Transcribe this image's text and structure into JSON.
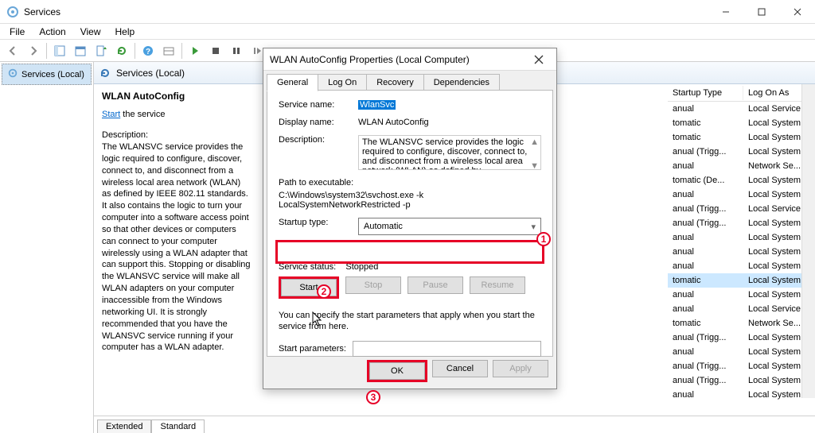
{
  "window": {
    "title": "Services"
  },
  "menu": {
    "file": "File",
    "action": "Action",
    "view": "View",
    "help": "Help"
  },
  "tree": {
    "root": "Services (Local)"
  },
  "svcHeader": "Services (Local)",
  "descPanel": {
    "name": "WLAN AutoConfig",
    "start_link": "Start",
    "start_suffix": " the service",
    "desc_label": "Description:",
    "desc_text": "The WLANSVC service provides the logic required to configure, discover, connect to, and disconnect from a wireless local area network (WLAN) as defined by IEEE 802.11 standards. It also contains the logic to turn your computer into a software access point so that other devices or computers can connect to your computer wirelessly using a WLAN adapter that can support this. Stopping or disabling the WLANSVC service will make all WLAN adapters on your computer inaccessible from the Windows networking UI. It is strongly recommended that you have the WLANSVC service running if your computer has a WLAN adapter."
  },
  "listHeader": {
    "startup": "Startup Type",
    "logon": "Log On As"
  },
  "rows": [
    {
      "st": "anual",
      "lo": "Local Service"
    },
    {
      "st": "tomatic",
      "lo": "Local System"
    },
    {
      "st": "tomatic",
      "lo": "Local System"
    },
    {
      "st": "anual (Trigg...",
      "lo": "Local System"
    },
    {
      "st": "anual",
      "lo": "Network Se..."
    },
    {
      "st": "tomatic (De...",
      "lo": "Local System"
    },
    {
      "st": "anual",
      "lo": "Local System"
    },
    {
      "st": "anual (Trigg...",
      "lo": "Local Service"
    },
    {
      "st": "anual (Trigg...",
      "lo": "Local System"
    },
    {
      "st": "anual",
      "lo": "Local System"
    },
    {
      "st": "anual",
      "lo": "Local System"
    },
    {
      "st": "anual",
      "lo": "Local System"
    },
    {
      "st": "tomatic",
      "lo": "Local System",
      "sel": true
    },
    {
      "st": "anual",
      "lo": "Local System"
    },
    {
      "st": "anual",
      "lo": "Local Service"
    },
    {
      "st": "tomatic",
      "lo": "Network Se..."
    },
    {
      "st": "anual (Trigg...",
      "lo": "Local System"
    },
    {
      "st": "anual",
      "lo": "Local System"
    },
    {
      "st": "anual (Trigg...",
      "lo": "Local System"
    },
    {
      "st": "anual (Trigg...",
      "lo": "Local System"
    },
    {
      "st": "anual",
      "lo": "Local System"
    }
  ],
  "tabs": {
    "extended": "Extended",
    "standard": "Standard"
  },
  "dialog": {
    "title": "WLAN AutoConfig Properties (Local Computer)",
    "tabs": {
      "general": "General",
      "logon": "Log On",
      "recovery": "Recovery",
      "deps": "Dependencies"
    },
    "svcname_lbl": "Service name:",
    "svcname_val": "WlanSvc",
    "disp_lbl": "Display name:",
    "disp_val": "WLAN AutoConfig",
    "desc_lbl": "Description:",
    "desc_val": "The WLANSVC service provides the logic required to configure, discover, connect to, and disconnect from a wireless local area network (WLAN) as defined by",
    "path_lbl": "Path to executable:",
    "path_val": "C:\\Windows\\system32\\svchost.exe -k LocalSystemNetworkRestricted -p",
    "startup_lbl": "Startup type:",
    "startup_val": "Automatic",
    "status_lbl": "Service status:",
    "status_val": "Stopped",
    "btn_start": "Start",
    "btn_stop": "Stop",
    "btn_pause": "Pause",
    "btn_resume": "Resume",
    "hint": "You can specify the start parameters that apply when you start the service from here.",
    "param_lbl": "Start parameters:",
    "ok": "OK",
    "cancel": "Cancel",
    "apply": "Apply"
  },
  "callouts": {
    "c1": "1",
    "c2": "2",
    "c3": "3"
  }
}
